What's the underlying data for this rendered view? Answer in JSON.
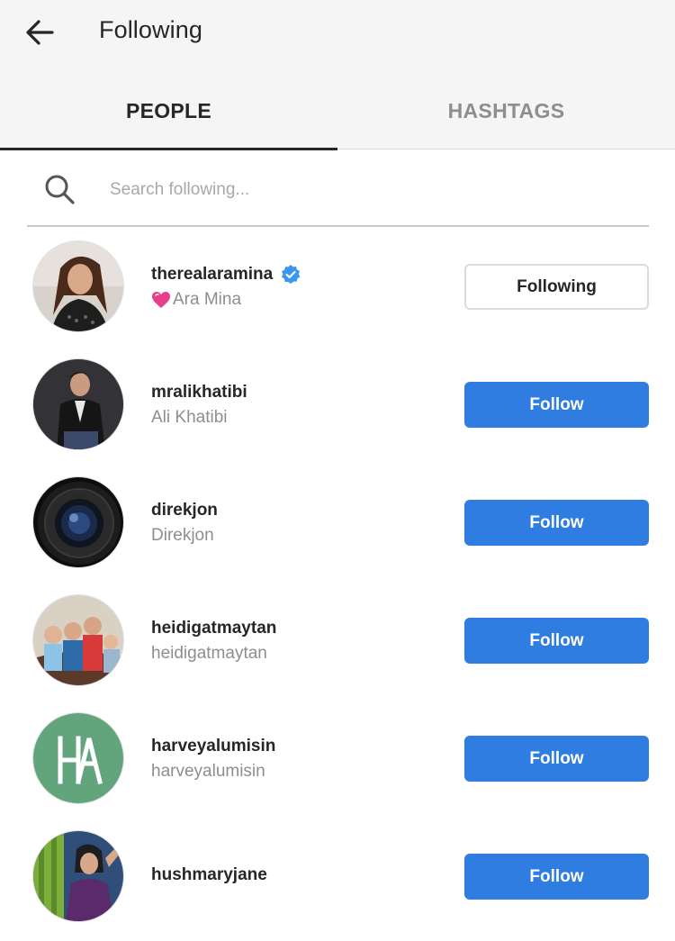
{
  "header": {
    "title": "Following"
  },
  "tabs": [
    {
      "label": "PEOPLE",
      "active": true
    },
    {
      "label": "HASHTAGS",
      "active": false
    }
  ],
  "search": {
    "placeholder": "Search following...",
    "value": ""
  },
  "accounts": [
    {
      "username": "therealaramina",
      "full_name": "Ara Mina",
      "name_prefix_icon": "pink-heart-icon",
      "verified": true,
      "button": "Following"
    },
    {
      "username": "mralikhatibi",
      "full_name": "Ali Khatibi",
      "verified": false,
      "button": "Follow"
    },
    {
      "username": "direkjon",
      "full_name": "Direkjon",
      "verified": false,
      "button": "Follow"
    },
    {
      "username": "heidigatmaytan",
      "full_name": "heidigatmaytan",
      "verified": false,
      "button": "Follow"
    },
    {
      "username": "harveyalumisin",
      "full_name": "harveyalumisin",
      "verified": false,
      "button": "Follow"
    },
    {
      "username": "hushmaryjane",
      "full_name": "",
      "verified": false,
      "button": "Follow"
    }
  ],
  "colors": {
    "follow_button": "#2f7de1",
    "verified_badge": "#3897f0",
    "header_background": "#f5f5f5"
  }
}
